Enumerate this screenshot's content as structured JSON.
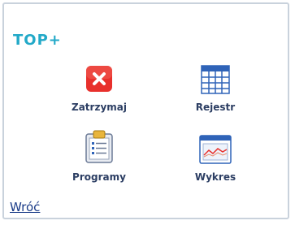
{
  "header": {
    "logo_text": "TOP+"
  },
  "tiles": [
    {
      "label": "Zatrzymaj",
      "icon": "stop-icon"
    },
    {
      "label": "Rejestr",
      "icon": "table-icon"
    },
    {
      "label": "Programy",
      "icon": "clipboard-icon"
    },
    {
      "label": "Wykres",
      "icon": "chart-window-icon"
    }
  ],
  "footer": {
    "back_label": "Wróć"
  },
  "colors": {
    "accent": "#22a9c8",
    "stop": "#e8302c",
    "link": "#1a3b88"
  }
}
